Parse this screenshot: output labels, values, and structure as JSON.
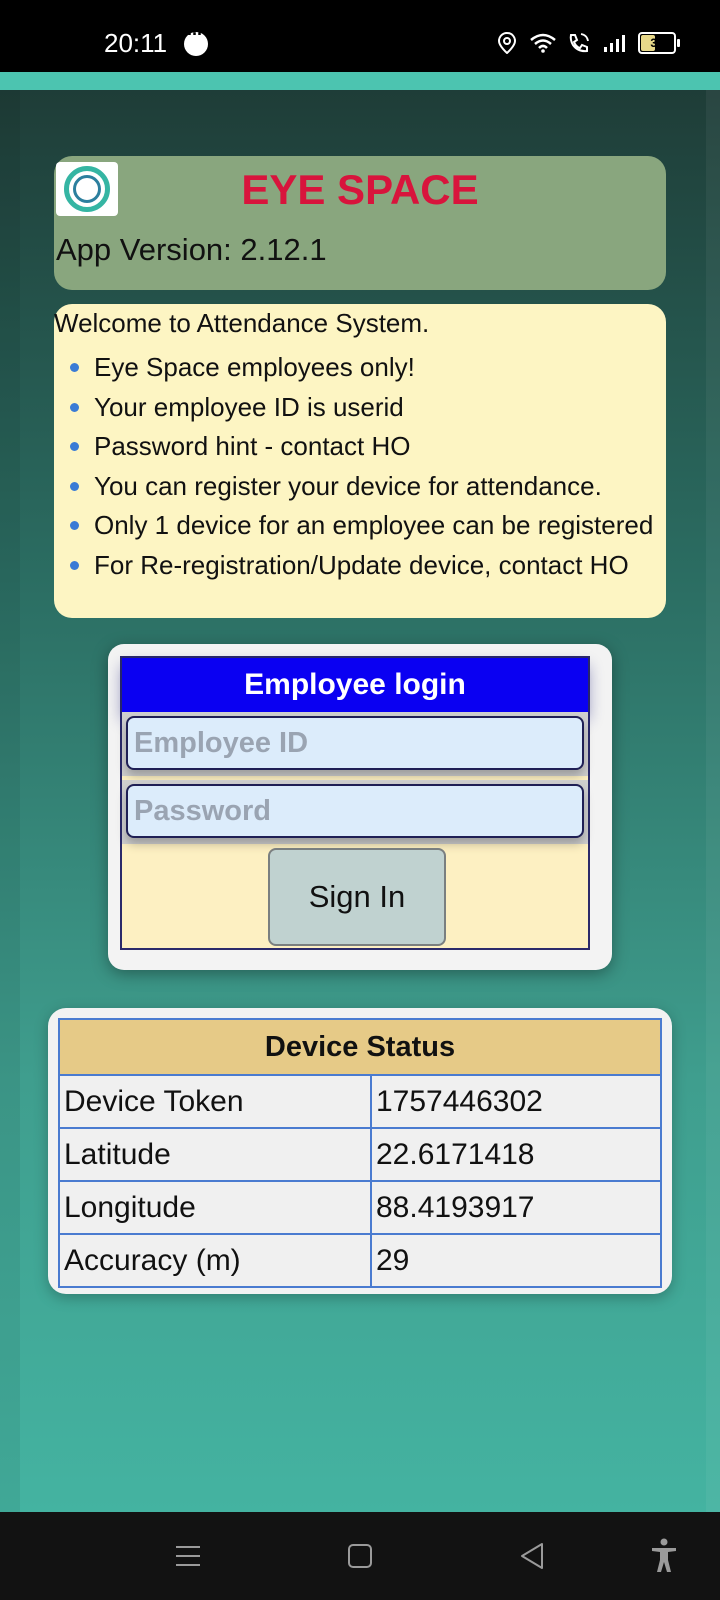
{
  "status_bar": {
    "time": "20:11",
    "battery": "34",
    "icons": [
      "chat-bubble-icon",
      "location-icon",
      "wifi-icon",
      "wifi-call-icon",
      "signal-icon",
      "battery-icon"
    ]
  },
  "header": {
    "title": "EYE SPACE",
    "version": "App Version: 2.12.1",
    "logo": "eye-space-logo"
  },
  "info": {
    "welcome": "Welcome to Attendance System.",
    "items": [
      "Eye Space employees only!",
      "Your employee ID is userid",
      "Password hint - contact HO",
      "You can register your device for attendance.",
      "Only 1 device for an employee can be registered",
      "For Re-registration/Update device, contact HO"
    ]
  },
  "login": {
    "title": "Employee login",
    "employee_id_placeholder": "Employee ID",
    "employee_id_value": "",
    "password_placeholder": "Password",
    "password_value": "",
    "sign_in_label": "Sign In"
  },
  "device_status": {
    "title": "Device Status",
    "rows": [
      {
        "label": "Device Token",
        "value": "1757446302"
      },
      {
        "label": "Latitude",
        "value": "22.6171418"
      },
      {
        "label": "Longitude",
        "value": "88.4193917"
      },
      {
        "label": "Accuracy (m)",
        "value": "29"
      }
    ]
  },
  "colors": {
    "title_red": "#d8143c",
    "login_header_blue": "#0a00f2",
    "status_header": "#e6ca87"
  }
}
